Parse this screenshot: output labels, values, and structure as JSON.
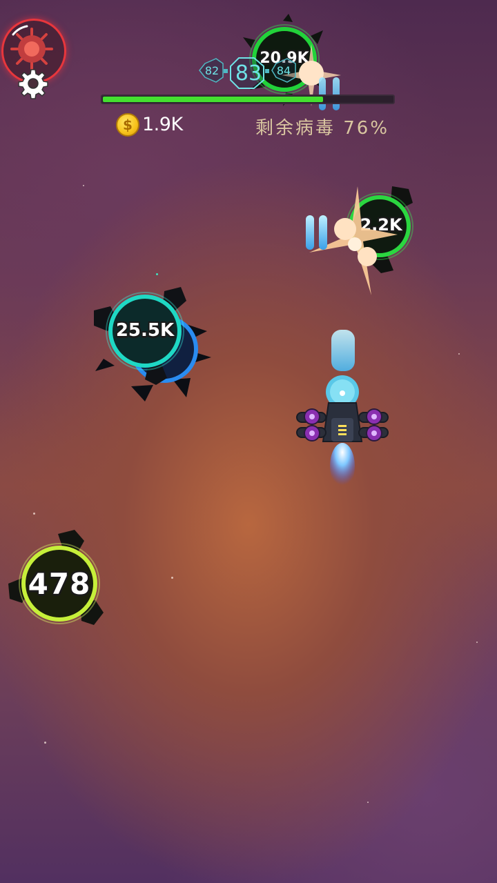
{
  "hud": {
    "level_prev": "82",
    "level_current": "83",
    "level_next": "84",
    "level_progress": 0.76,
    "coins": "1.9K",
    "virus_remaining_text": "剩余病毒 76%"
  },
  "icons": {
    "boss": "virus-boss-icon",
    "settings": "gear-icon",
    "coin": "coin-icon",
    "player": "spaceship-icon"
  },
  "viruses": [
    {
      "name": "virus-green-top",
      "hp": "20.9K",
      "color": "#2ee04a"
    },
    {
      "name": "virus-green-right",
      "hp": "2.2K",
      "color": "#36e04a"
    },
    {
      "name": "virus-cyan",
      "hp": "25.5K",
      "color": "#1fd8c4"
    },
    {
      "name": "virus-lime",
      "hp": "478",
      "color": "#c6ef3a"
    }
  ],
  "colors": {
    "progress_fill": "#44e030",
    "level_text": "#6fe3e6",
    "boss_ring": "#e8363c"
  }
}
